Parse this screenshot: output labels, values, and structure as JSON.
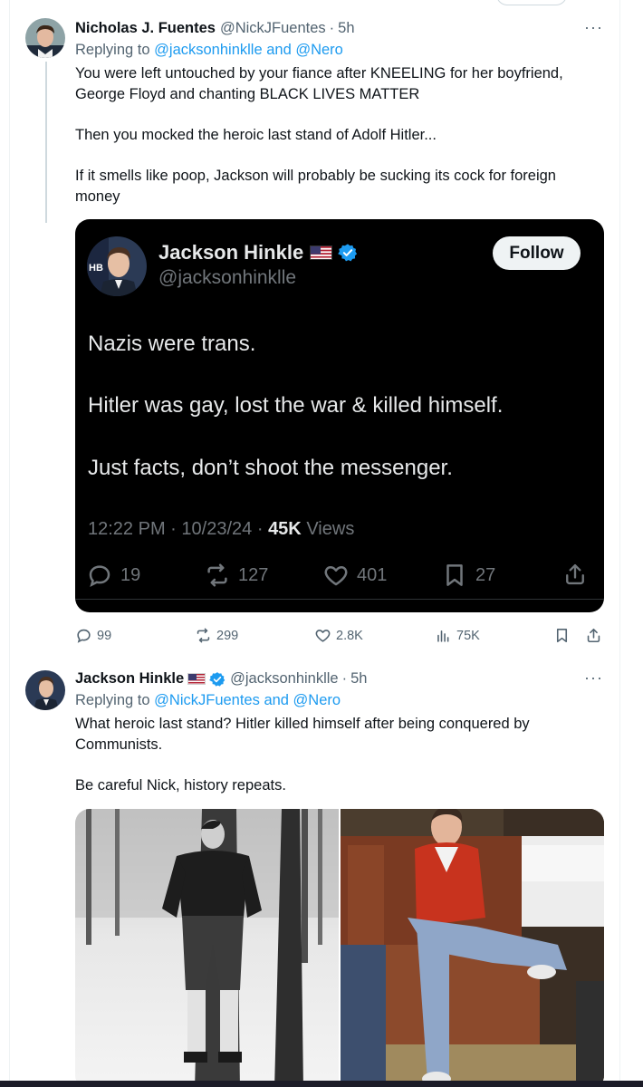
{
  "tweet1": {
    "name": "Nicholas J. Fuentes",
    "handle": "@NickJFuentes",
    "sep": "·",
    "time": "5h",
    "replying_prefix": "Replying to",
    "replying_to": "@jacksonhinklle and @Nero",
    "paragraphs": [
      "You were left untouched by your fiance after KNEELING for her boyfriend, George Floyd and chanting BLACK LIVES MATTER",
      "Then you mocked the heroic last stand of Adolf Hitler...",
      "If it smells like poop, Jackson will probably be sucking its cock for foreign money"
    ],
    "more": "···",
    "actions": {
      "replies": "99",
      "reposts": "299",
      "likes": "2.8K",
      "views": "75K"
    }
  },
  "quoted": {
    "name": "Jackson Hinkle",
    "handle": "@jacksonhinklle",
    "follow_label": "Follow",
    "avatar_badge": "HB",
    "lines": [
      "Nazis were trans.",
      "Hitler was gay, lost the war & killed himself.",
      "Just facts, don’t shoot the messenger."
    ],
    "time": "12:22 PM",
    "date": "10/23/24",
    "sep": "·",
    "views_count": "45K",
    "views_label": "Views",
    "actions": {
      "replies": "19",
      "reposts": "127",
      "likes": "401",
      "bookmarks": "27"
    }
  },
  "tweet2": {
    "name": "Jackson Hinkle",
    "handle": "@jacksonhinklle",
    "sep": "·",
    "time": "5h",
    "replying_prefix": "Replying to",
    "replying_to": "@NickJFuentes and @Nero",
    "paragraphs": [
      "What heroic last stand? Hitler killed himself after being conquered by Communists.",
      "Be careful Nick, history repeats."
    ],
    "more": "···"
  },
  "colors": {
    "text": "#0f1419",
    "secondary": "#536471",
    "link": "#1d9bf0",
    "verified": "#1d9bf0",
    "card_bg": "#000000"
  },
  "icons": [
    "reply-icon",
    "repost-icon",
    "like-icon",
    "views-icon",
    "bookmark-icon",
    "share-icon",
    "verified-badge-icon",
    "us-flag-icon",
    "more-icon"
  ]
}
